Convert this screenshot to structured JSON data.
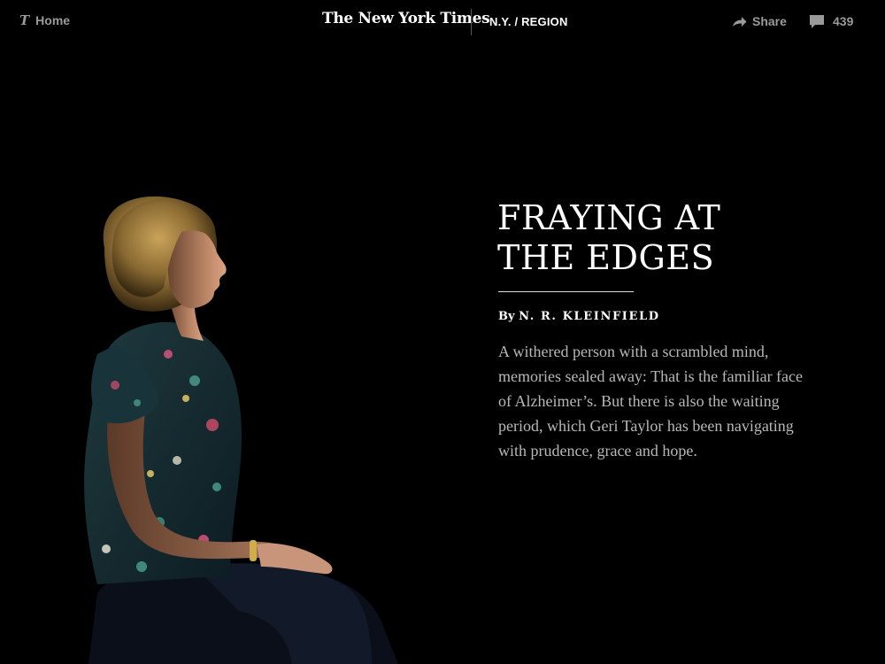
{
  "header": {
    "home_label": "Home",
    "home_logo": "𝕿",
    "masthead": "The New York Times",
    "section": "N.Y. / REGION",
    "share_label": "Share",
    "comment_count": "439"
  },
  "article": {
    "headline_line1": "FRAYING AT",
    "headline_line2": "THE EDGES",
    "byline_prefix": "By",
    "byline_author": "N. R. KLEINFIELD",
    "summary": "A withered person with a scrambled mind, memories sealed away: That is the familiar face of Alzheimer’s. But there is also the waiting period, which Geri Taylor has been navigating with prudence, grace and hope."
  },
  "icons": {
    "home": "nyt-t-logo-icon",
    "share": "share-arrow-icon",
    "comments": "comment-bubble-icon"
  },
  "colors": {
    "background": "#000000",
    "text_primary": "#ffffff",
    "text_muted": "#9a9a9a",
    "summary_text": "#b8b8b8"
  }
}
